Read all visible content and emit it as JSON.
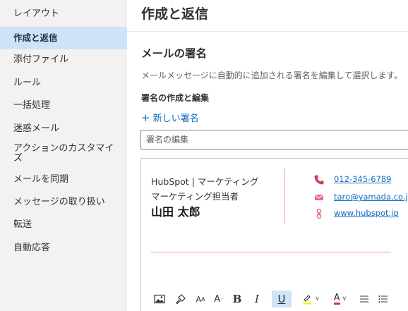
{
  "sidebar": {
    "items": [
      {
        "label": "レイアウト"
      },
      {
        "label": "作成と返信"
      },
      {
        "label": "添付ファイル"
      },
      {
        "label": "ルール"
      },
      {
        "label": "一括処理"
      },
      {
        "label": "迷惑メール"
      },
      {
        "label": "アクションのカスタマイズ"
      },
      {
        "label": "メールを同期"
      },
      {
        "label": "メッセージの取り扱い"
      },
      {
        "label": "転送"
      },
      {
        "label": "自動応答"
      }
    ]
  },
  "main": {
    "title": "作成と返信",
    "section_title": "メールの署名",
    "description": "メールメッセージに自動的に追加される署名を編集して選択します。",
    "subheading": "署名の作成と編集",
    "new_signature_label": "新しい署名",
    "signature_name_placeholder": "署名の編集",
    "signature": {
      "company": "HubSpot | マーケティング",
      "role": "マーケティング担当者",
      "name": "山田 太郎",
      "phone": "012-345-6789",
      "email": "taro@yamada.co.jp",
      "website": "www.hubspot.jp"
    },
    "toolbar": {
      "bold": "B",
      "italic": "I",
      "underline": "U",
      "font_size": "A",
      "font_color": "A"
    }
  },
  "colors": {
    "accent": "#0f6cbd",
    "selected_nav": "#cfe3f8",
    "signature_pink": "#e8a0b4",
    "phone_icon": "#d93668",
    "highlight_yellow": "#fff100",
    "font_red": "#d13438"
  }
}
